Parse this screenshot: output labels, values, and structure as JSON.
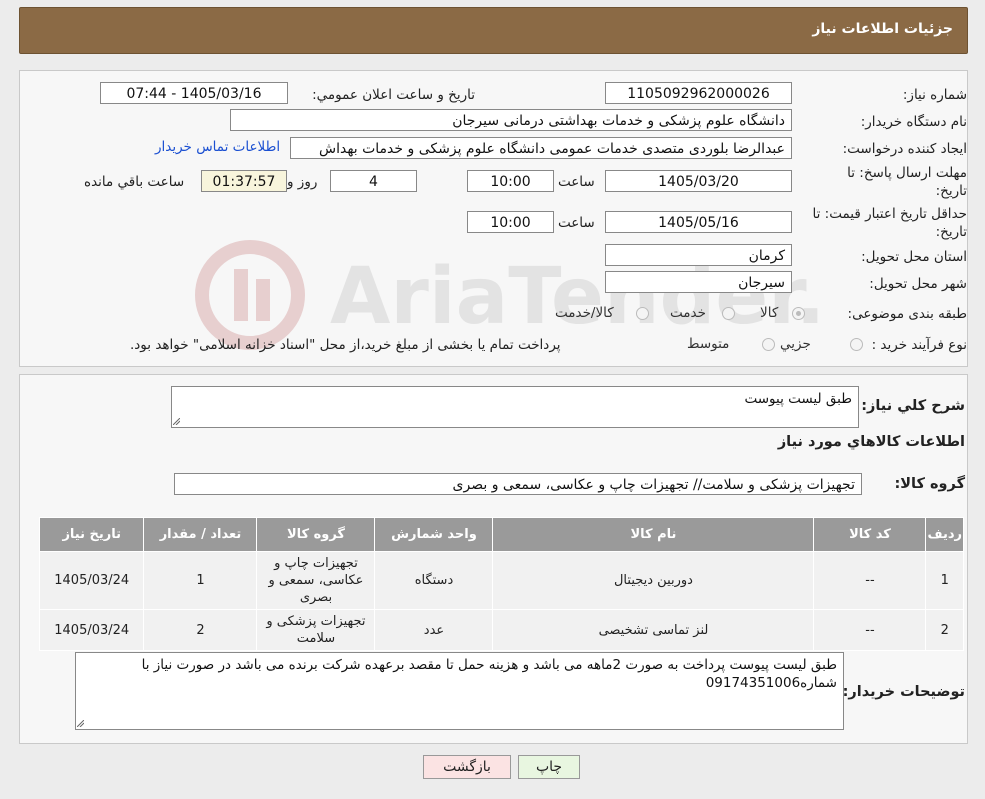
{
  "header": {
    "title": "جزئیات اطلاعات نیاز"
  },
  "fields": {
    "need_number_label": "شماره نیاز:",
    "need_number": "1105092962000026",
    "announce_label": "تاریخ و ساعت اعلان عمومي:",
    "announce_value": "1405/03/16 - 07:44",
    "buyer_org_label": "نام دستگاه خريدار:",
    "buyer_org": "دانشگاه علوم پزشکی و خدمات بهداشتی درمانی سیرجان",
    "requester_label": "ايجاد کننده درخواست:",
    "requester": "عبدالرضا بلوردی متصدی خدمات عمومی  دانشگاه علوم پزشکی و خدمات بهداش",
    "buyer_contact_link": "اطلاعات تماس خريدار",
    "deadline_label_1": "مهلت ارسال پاسخ: تا",
    "deadline_label_2": "تاريخ:",
    "deadline_date": "1405/03/20",
    "time_label": "ساعت",
    "deadline_time": "10:00",
    "days_value": "4",
    "days_label": "روز و",
    "remaining_time": "01:37:57",
    "remaining_label": "ساعت باقي مانده",
    "validity_label_1": "حداقل تاريخ اعتبار قيمت: تا",
    "validity_label_2": "تاريخ:",
    "validity_date": "1405/05/16",
    "validity_time_label": "ساعت",
    "validity_time": "10:00",
    "province_label": "استان محل تحويل:",
    "province": "کرمان",
    "city_label": "شهر محل تحويل:",
    "city": "سیرجان",
    "category_label": "طبقه بندی موضوعی:",
    "category_options": [
      "کالا",
      "خدمت",
      "کالا/خدمت"
    ],
    "process_label": "نوع فرآيند خريد :",
    "process_options": [
      "جزيي",
      "متوسط"
    ],
    "process_note": "پرداخت تمام يا بخشی از مبلغ خريد،از محل \"اسناد خزانه اسلامی\" خواهد بود."
  },
  "summary": {
    "description_label": "شرح کلي نياز:",
    "description": "طبق لیست پیوست",
    "goods_info_title": "اطلاعات کالاهاي مورد نياز",
    "goods_group_label": "گروه کالا:",
    "goods_group": "تجهیزات پزشکی و سلامت// تجهیزات چاپ و عکاسی، سمعی و بصری"
  },
  "table": {
    "headers": [
      "رديف",
      "کد کالا",
      "نام کالا",
      "واحد شمارش",
      "گروه کالا",
      "تعداد / مقدار",
      "تاريخ نياز"
    ],
    "rows": [
      [
        "1",
        "--",
        "دوربین دیجیتال",
        "دستگاه",
        "تجهیزات چاپ و عکاسی، سمعی و بصری",
        "1",
        "1405/03/24"
      ],
      [
        "2",
        "--",
        "لنز تماسی تشخیصی",
        "عدد",
        "تجهیزات پزشکی و سلامت",
        "2",
        "1405/03/24"
      ]
    ]
  },
  "buyer_notes": {
    "label": "توضيحات خريدار:",
    "text": "طبق لیست پیوست پرداخت به صورت 2ماهه می باشد و هزینه حمل تا مقصد برعهده شرکت برنده می باشد در صورت نیاز با شماره09174351006"
  },
  "buttons": {
    "print": "چاپ",
    "back": "بازگشت"
  },
  "watermark": {
    "text": "AriaTender.neT"
  },
  "colors": {
    "header_bg": "#8b6a45",
    "table_header_bg": "#9a9a9a",
    "link": "#1a4fd1",
    "print_bg": "#e8f6e0",
    "back_bg": "#fbe3e3"
  }
}
